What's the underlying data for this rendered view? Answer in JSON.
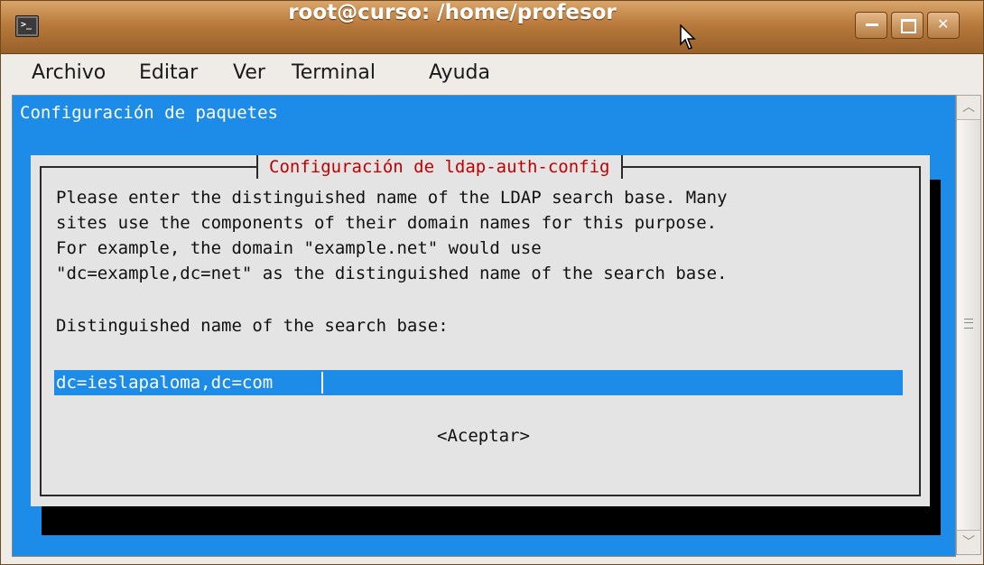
{
  "window": {
    "title": "root@curso: /home/profesor",
    "buttons": {
      "minimize": "minimize",
      "maximize": "maximize",
      "close": "close"
    }
  },
  "menu": [
    "Archivo",
    "Editar",
    "Ver",
    "Terminal",
    "Ayuda"
  ],
  "terminal": {
    "header": "Configuración de paquetes",
    "dialog": {
      "title": "Configuración de ldap-auth-config",
      "lines": [
        "Please enter the distinguished name of the LDAP search base. Many",
        "sites use the components of their domain names for this purpose.",
        "For example, the domain \"example.net\" would use",
        "\"dc=example,dc=net\" as the distinguished name of the search base."
      ],
      "prompt": "Distinguished name of the search base:",
      "input_value": "dc=ieslapaloma,dc=com",
      "ok_button": "<Aceptar>"
    }
  },
  "colors": {
    "terminal_bg": "#1d8ce8",
    "dialog_bg": "#e4e4e4",
    "dialog_title": "#c00000",
    "titlebar": "#b97a3b"
  }
}
